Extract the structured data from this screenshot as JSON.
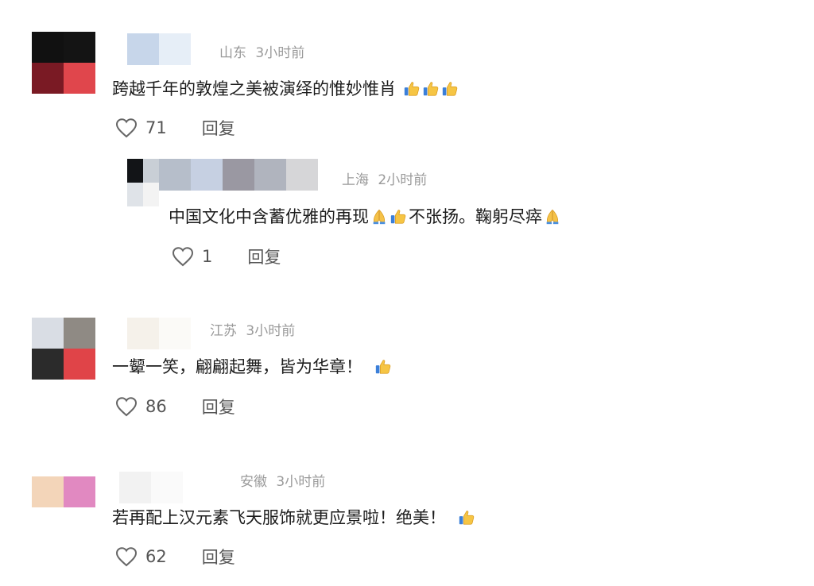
{
  "comments": [
    {
      "location": "山东",
      "time": "3小时前",
      "text": "跨越千年的敦煌之美被演绎的惟妙惟肖",
      "emojis": [
        "thumbs-up",
        "thumbs-up",
        "thumbs-up"
      ],
      "likes": "71",
      "reply_label": "回复",
      "avatar_colors": [
        "#111111",
        "#141414",
        "#7a1a24",
        "#e0464c"
      ],
      "name_mosaic_colors": [
        "#c7d6ea",
        "#e6eef7"
      ]
    },
    {
      "location": "上海",
      "time": "2小时前",
      "text_part1": "中国文化中含蓄优雅的再现",
      "text_part2": "不张扬。鞠躬尽瘁",
      "emojis_part1": [
        "folded-hands",
        "thumbs-up"
      ],
      "emojis_part2": [
        "folded-hands"
      ],
      "likes": "1",
      "reply_label": "回复",
      "avatar_colors": [
        "#121417",
        "#c9cfd6",
        "#dfe3e8",
        "#f3f3f3"
      ],
      "name_mosaic_colors": [
        "#b6beca",
        "#c6d0e2",
        "#9a98a2",
        "#b0b4be",
        "#d6d6d8"
      ]
    },
    {
      "location": "江苏",
      "time": "3小时前",
      "text": "一颦一笑，翩翩起舞，皆为华章！",
      "emojis": [
        "thumbs-up"
      ],
      "likes": "86",
      "reply_label": "回复",
      "avatar_colors": [
        "#d9dde4",
        "#8f8a84",
        "#2b2b2b",
        "#e04448"
      ],
      "name_mosaic_colors": [
        "#f5f1ea",
        "#fbfaf7"
      ]
    },
    {
      "location": "安徽",
      "time": "3小时前",
      "text": "若再配上汉元素飞天服饰就更应景啦！绝美！",
      "emojis": [
        "thumbs-up"
      ],
      "likes": "62",
      "reply_label": "回复",
      "avatar_colors": [
        "#f3d5b9",
        "#e189c1",
        "#ffffff",
        "#ffffff"
      ],
      "name_mosaic_colors": [
        "#f2f2f2",
        "#fafafa"
      ]
    }
  ]
}
